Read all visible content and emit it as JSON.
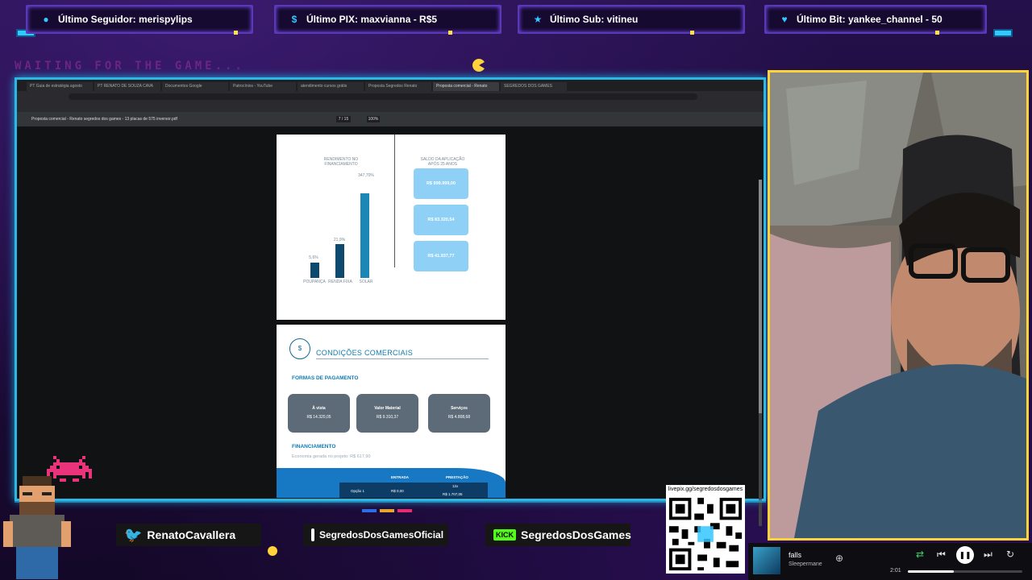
{
  "tickers": [
    {
      "label": "Último Seguidor: merispylips",
      "icon": "user-icon"
    },
    {
      "label": "Último PIX: maxvianna - R$5",
      "icon": "dollar-icon"
    },
    {
      "label": "Último Sub: vitineu",
      "icon": "star-icon"
    },
    {
      "label": "Último Bit: yankee_channel - 50",
      "icon": "heart-icon"
    }
  ],
  "waiting_text": "WAITING FOR THE GAME...",
  "browser": {
    "tabs": [
      "PT Guia de estratégia agosto",
      "PT RENATO DE SOUZA CAVA",
      "Documentos Google",
      "Patrocínios - YouTube",
      "atendimento cursos grátis",
      "Proposta Segredos Renato",
      "Proposta comercial - Renato",
      "SEGREDOS DOS GAMES"
    ],
    "active_tab_index": 6,
    "pdf_title": "Proposta comercial - Renato segredos dos games - 13 placas de 575 inversor.pdf",
    "page": "7 / 15",
    "zoom": "100%"
  },
  "pdf": {
    "chart_heading": "RENDIMENTO NO FINANCIAMENTO",
    "chart_pct_label": "347,70%",
    "bar_labels": [
      "POUPANÇA",
      "RENDA FIXA",
      "SOLAR"
    ],
    "bar_pct_labels": [
      "5,6%",
      "21,9%",
      "347,70%"
    ],
    "bar_values": [
      0.15,
      0.33,
      0.82
    ],
    "right_heading": "SALDO DA APLICAÇÃO APÓS 25 ANOS",
    "value_boxes": [
      "R$ 999.999,00",
      "R$ 83.320,54",
      "R$ 41.937,77"
    ],
    "cc_title": "CONDIÇÕES COMERCIAIS",
    "payment_heading": "FORMAS DE PAGAMENTO",
    "payment_options": [
      {
        "title": "À vista",
        "value": "R$ 14.320,05"
      },
      {
        "title": "Valor Material",
        "value": "R$ 9.310,37"
      },
      {
        "title": "Serviços",
        "value": "R$ 4.808,68"
      }
    ],
    "financing_heading": "FINANCIAMENTO",
    "economy_text": "Economia gerada no projeto: R$ 617,90",
    "table_headers": [
      "ENTRADA",
      "PRESTAÇÃO"
    ],
    "table_row": {
      "option": "Opção 1",
      "entry": "R$ 0,00",
      "installment_count": "12x",
      "installment": "R$ 1.707,05"
    }
  },
  "social": {
    "twitter": "RenatoCavallera",
    "instagram": "SegredosDosGamesOficial",
    "kick": "SegredosDosGames",
    "kick_badge": "KICK"
  },
  "qr_label": "livepix.gg/segredosdosgames",
  "music": {
    "title": "falls",
    "artist": "Sleepermane",
    "time": "2:01",
    "progress": 0.4
  }
}
